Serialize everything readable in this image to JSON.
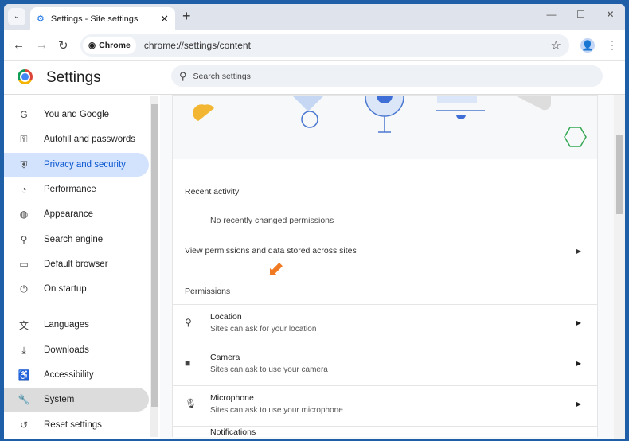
{
  "tab": {
    "title": "Settings - Site settings",
    "close": "✕"
  },
  "toolbar": {
    "chip": "Chrome",
    "url": "chrome://settings/content"
  },
  "header": {
    "title": "Settings",
    "search_placeholder": "Search settings"
  },
  "sidebar": {
    "items": [
      {
        "label": "You and Google",
        "icon": "G"
      },
      {
        "label": "Autofill and passwords",
        "icon": "⚿"
      },
      {
        "label": "Privacy and security",
        "icon": "⛨"
      },
      {
        "label": "Performance",
        "icon": "◔"
      },
      {
        "label": "Appearance",
        "icon": "◍"
      },
      {
        "label": "Search engine",
        "icon": "⚲"
      },
      {
        "label": "Default browser",
        "icon": "▭"
      },
      {
        "label": "On startup",
        "icon": "⏻"
      },
      {
        "label": "Languages",
        "icon": "文"
      },
      {
        "label": "Downloads",
        "icon": "⤓"
      },
      {
        "label": "Accessibility",
        "icon": "♿"
      },
      {
        "label": "System",
        "icon": "🔧"
      },
      {
        "label": "Reset settings",
        "icon": "↺"
      }
    ]
  },
  "main": {
    "recent_activity": "Recent activity",
    "no_recent": "No recently changed permissions",
    "view_permissions": "View permissions and data stored across sites",
    "permissions": "Permissions",
    "perm_items": [
      {
        "title": "Location",
        "sub": "Sites can ask for your location",
        "icon": "⚲"
      },
      {
        "title": "Camera",
        "sub": "Sites can ask to use your camera",
        "icon": "■"
      },
      {
        "title": "Microphone",
        "sub": "Sites can ask to use your microphone",
        "icon": "🎙"
      },
      {
        "title": "Notifications",
        "sub": "",
        "icon": ""
      }
    ]
  }
}
